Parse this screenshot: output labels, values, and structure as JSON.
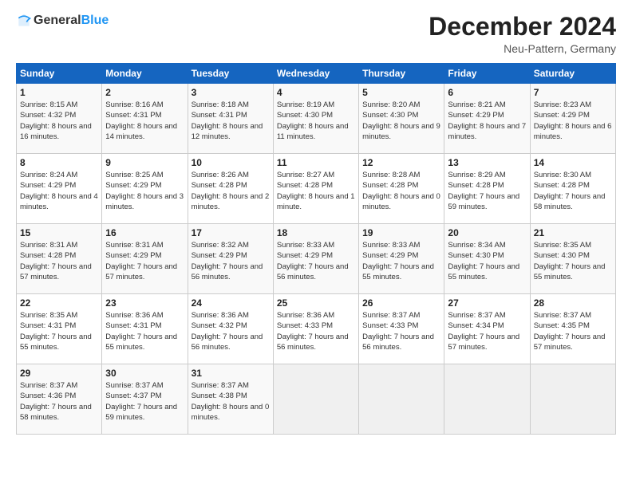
{
  "logo": {
    "general": "General",
    "blue": "Blue"
  },
  "header": {
    "month": "December 2024",
    "location": "Neu-Pattern, Germany"
  },
  "days_of_week": [
    "Sunday",
    "Monday",
    "Tuesday",
    "Wednesday",
    "Thursday",
    "Friday",
    "Saturday"
  ],
  "weeks": [
    [
      {
        "day": "1",
        "sunrise": "Sunrise: 8:15 AM",
        "sunset": "Sunset: 4:32 PM",
        "daylight": "Daylight: 8 hours and 16 minutes."
      },
      {
        "day": "2",
        "sunrise": "Sunrise: 8:16 AM",
        "sunset": "Sunset: 4:31 PM",
        "daylight": "Daylight: 8 hours and 14 minutes."
      },
      {
        "day": "3",
        "sunrise": "Sunrise: 8:18 AM",
        "sunset": "Sunset: 4:31 PM",
        "daylight": "Daylight: 8 hours and 12 minutes."
      },
      {
        "day": "4",
        "sunrise": "Sunrise: 8:19 AM",
        "sunset": "Sunset: 4:30 PM",
        "daylight": "Daylight: 8 hours and 11 minutes."
      },
      {
        "day": "5",
        "sunrise": "Sunrise: 8:20 AM",
        "sunset": "Sunset: 4:30 PM",
        "daylight": "Daylight: 8 hours and 9 minutes."
      },
      {
        "day": "6",
        "sunrise": "Sunrise: 8:21 AM",
        "sunset": "Sunset: 4:29 PM",
        "daylight": "Daylight: 8 hours and 7 minutes."
      },
      {
        "day": "7",
        "sunrise": "Sunrise: 8:23 AM",
        "sunset": "Sunset: 4:29 PM",
        "daylight": "Daylight: 8 hours and 6 minutes."
      }
    ],
    [
      {
        "day": "8",
        "sunrise": "Sunrise: 8:24 AM",
        "sunset": "Sunset: 4:29 PM",
        "daylight": "Daylight: 8 hours and 4 minutes."
      },
      {
        "day": "9",
        "sunrise": "Sunrise: 8:25 AM",
        "sunset": "Sunset: 4:29 PM",
        "daylight": "Daylight: 8 hours and 3 minutes."
      },
      {
        "day": "10",
        "sunrise": "Sunrise: 8:26 AM",
        "sunset": "Sunset: 4:28 PM",
        "daylight": "Daylight: 8 hours and 2 minutes."
      },
      {
        "day": "11",
        "sunrise": "Sunrise: 8:27 AM",
        "sunset": "Sunset: 4:28 PM",
        "daylight": "Daylight: 8 hours and 1 minute."
      },
      {
        "day": "12",
        "sunrise": "Sunrise: 8:28 AM",
        "sunset": "Sunset: 4:28 PM",
        "daylight": "Daylight: 8 hours and 0 minutes."
      },
      {
        "day": "13",
        "sunrise": "Sunrise: 8:29 AM",
        "sunset": "Sunset: 4:28 PM",
        "daylight": "Daylight: 7 hours and 59 minutes."
      },
      {
        "day": "14",
        "sunrise": "Sunrise: 8:30 AM",
        "sunset": "Sunset: 4:28 PM",
        "daylight": "Daylight: 7 hours and 58 minutes."
      }
    ],
    [
      {
        "day": "15",
        "sunrise": "Sunrise: 8:31 AM",
        "sunset": "Sunset: 4:28 PM",
        "daylight": "Daylight: 7 hours and 57 minutes."
      },
      {
        "day": "16",
        "sunrise": "Sunrise: 8:31 AM",
        "sunset": "Sunset: 4:29 PM",
        "daylight": "Daylight: 7 hours and 57 minutes."
      },
      {
        "day": "17",
        "sunrise": "Sunrise: 8:32 AM",
        "sunset": "Sunset: 4:29 PM",
        "daylight": "Daylight: 7 hours and 56 minutes."
      },
      {
        "day": "18",
        "sunrise": "Sunrise: 8:33 AM",
        "sunset": "Sunset: 4:29 PM",
        "daylight": "Daylight: 7 hours and 56 minutes."
      },
      {
        "day": "19",
        "sunrise": "Sunrise: 8:33 AM",
        "sunset": "Sunset: 4:29 PM",
        "daylight": "Daylight: 7 hours and 55 minutes."
      },
      {
        "day": "20",
        "sunrise": "Sunrise: 8:34 AM",
        "sunset": "Sunset: 4:30 PM",
        "daylight": "Daylight: 7 hours and 55 minutes."
      },
      {
        "day": "21",
        "sunrise": "Sunrise: 8:35 AM",
        "sunset": "Sunset: 4:30 PM",
        "daylight": "Daylight: 7 hours and 55 minutes."
      }
    ],
    [
      {
        "day": "22",
        "sunrise": "Sunrise: 8:35 AM",
        "sunset": "Sunset: 4:31 PM",
        "daylight": "Daylight: 7 hours and 55 minutes."
      },
      {
        "day": "23",
        "sunrise": "Sunrise: 8:36 AM",
        "sunset": "Sunset: 4:31 PM",
        "daylight": "Daylight: 7 hours and 55 minutes."
      },
      {
        "day": "24",
        "sunrise": "Sunrise: 8:36 AM",
        "sunset": "Sunset: 4:32 PM",
        "daylight": "Daylight: 7 hours and 56 minutes."
      },
      {
        "day": "25",
        "sunrise": "Sunrise: 8:36 AM",
        "sunset": "Sunset: 4:33 PM",
        "daylight": "Daylight: 7 hours and 56 minutes."
      },
      {
        "day": "26",
        "sunrise": "Sunrise: 8:37 AM",
        "sunset": "Sunset: 4:33 PM",
        "daylight": "Daylight: 7 hours and 56 minutes."
      },
      {
        "day": "27",
        "sunrise": "Sunrise: 8:37 AM",
        "sunset": "Sunset: 4:34 PM",
        "daylight": "Daylight: 7 hours and 57 minutes."
      },
      {
        "day": "28",
        "sunrise": "Sunrise: 8:37 AM",
        "sunset": "Sunset: 4:35 PM",
        "daylight": "Daylight: 7 hours and 57 minutes."
      }
    ],
    [
      {
        "day": "29",
        "sunrise": "Sunrise: 8:37 AM",
        "sunset": "Sunset: 4:36 PM",
        "daylight": "Daylight: 7 hours and 58 minutes."
      },
      {
        "day": "30",
        "sunrise": "Sunrise: 8:37 AM",
        "sunset": "Sunset: 4:37 PM",
        "daylight": "Daylight: 7 hours and 59 minutes."
      },
      {
        "day": "31",
        "sunrise": "Sunrise: 8:37 AM",
        "sunset": "Sunset: 4:38 PM",
        "daylight": "Daylight: 8 hours and 0 minutes."
      },
      null,
      null,
      null,
      null
    ]
  ]
}
